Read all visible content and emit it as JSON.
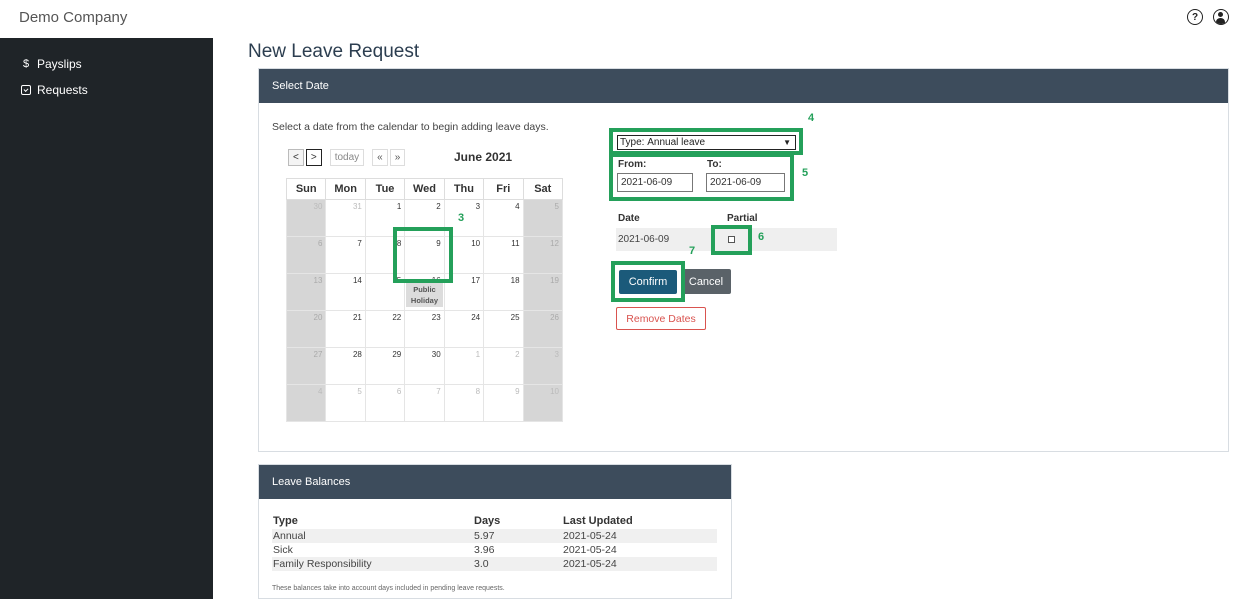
{
  "header": {
    "company": "Demo Company",
    "help_icon": "question-circle-icon",
    "user_icon": "user-circle-icon"
  },
  "sidebar": {
    "items": [
      {
        "icon": "dollar-icon",
        "glyph": "$",
        "label": "Payslips"
      },
      {
        "icon": "calendar-check-icon",
        "label": "Requests"
      }
    ]
  },
  "page": {
    "title": "New Leave Request"
  },
  "select_date": {
    "header": "Select Date",
    "instruction": "Select a date from the calendar to begin adding leave days.",
    "calendar": {
      "prev": "<",
      "next": ">",
      "today": "today",
      "prev_year": "«",
      "next_year": "»",
      "month": "June 2021",
      "weekdays": [
        "Sun",
        "Mon",
        "Tue",
        "Wed",
        "Thu",
        "Fri",
        "Sat"
      ],
      "weeks": [
        [
          "30",
          "31",
          "1",
          "2",
          "3",
          "4",
          "5"
        ],
        [
          "6",
          "7",
          "8",
          "9",
          "10",
          "11",
          "12"
        ],
        [
          "13",
          "14",
          "15",
          "16",
          "17",
          "18",
          "19"
        ],
        [
          "20",
          "21",
          "22",
          "23",
          "24",
          "25",
          "26"
        ],
        [
          "27",
          "28",
          "29",
          "30",
          "1",
          "2",
          "3"
        ],
        [
          "4",
          "5",
          "6",
          "7",
          "8",
          "9",
          "10"
        ]
      ],
      "holiday_label": "Public Holiday"
    },
    "form": {
      "type_label": "Type:",
      "type_value": "Annual leave",
      "from_label": "From:",
      "from_value": "2021-06-09",
      "to_label": "To:",
      "to_value": "2021-06-09",
      "date_col": "Date",
      "partial_col": "Partial",
      "row_date": "2021-06-09",
      "confirm": "Confirm",
      "cancel": "Cancel",
      "remove": "Remove Dates"
    },
    "annotations": [
      "3",
      "4",
      "5",
      "6",
      "7"
    ],
    "annotation_color": "#24a05a"
  },
  "leave_balances": {
    "header": "Leave Balances",
    "columns": [
      "Type",
      "Days",
      "Last Updated"
    ],
    "rows": [
      [
        "Annual",
        "5.97",
        "2021-05-24"
      ],
      [
        "Sick",
        "3.96",
        "2021-05-24"
      ],
      [
        "Family Responsibility",
        "3.0",
        "2021-05-24"
      ]
    ],
    "note": "These balances take into account days included in pending leave requests."
  }
}
